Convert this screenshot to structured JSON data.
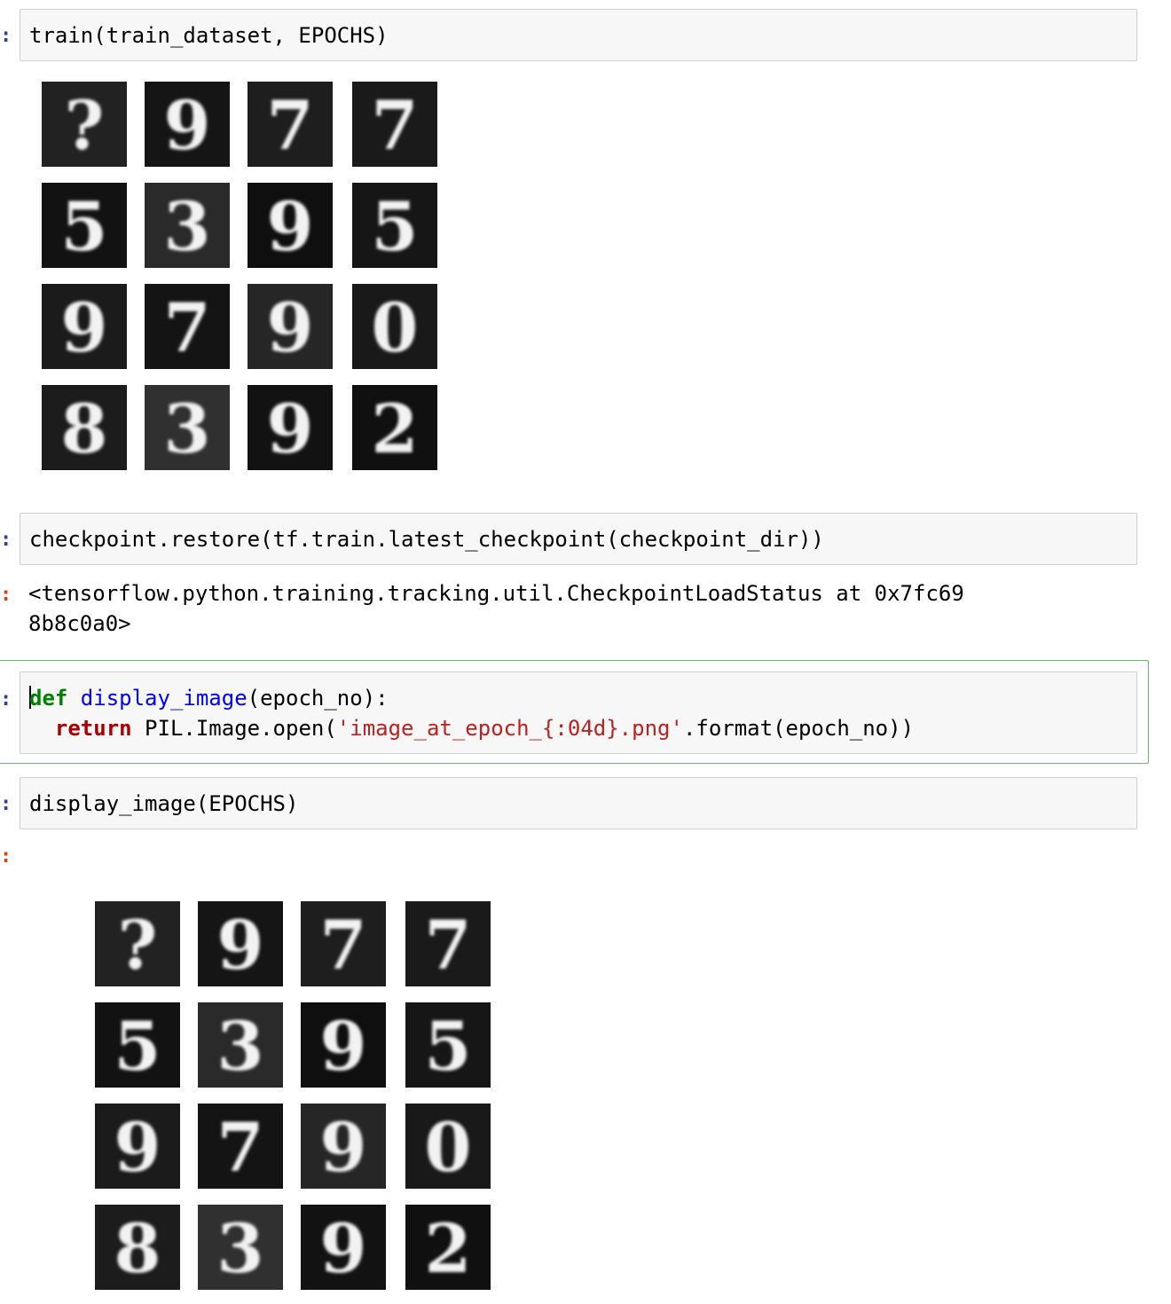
{
  "cells": [
    {
      "prompt": ":",
      "code": "train(train_dataset, EPOCHS)"
    },
    {
      "prompt": ":",
      "code": "checkpoint.restore(tf.train.latest_checkpoint(checkpoint_dir))",
      "output_prompt": ":",
      "output_line1": "<tensorflow.python.training.tracking.util.CheckpointLoadStatus at 0x7fc69",
      "output_line2": "8b8c0a0>"
    },
    {
      "prompt": ":",
      "code_line1": {
        "kw": "def",
        "fn": " display_image",
        "rest": "(epoch_no):"
      },
      "code_line2": {
        "indent": "  ",
        "kw": "return",
        "pre": " PIL.Image.open(",
        "str": "'image_at_epoch_{:04d}.png'",
        "post": ".format(epoch_no))"
      }
    },
    {
      "prompt": ":",
      "code": "display_image(EPOCHS)",
      "output_prompt": ":"
    }
  ],
  "digit_grid": {
    "digits": [
      [
        "?",
        "9",
        "7",
        "7"
      ],
      [
        "5",
        "3",
        "9",
        "5"
      ],
      [
        "9",
        "7",
        "9",
        "0"
      ],
      [
        "8",
        "3",
        "9",
        "2"
      ]
    ],
    "backgrounds": [
      [
        "#222222",
        "#151515",
        "#1e1e1e",
        "#1a1a1a"
      ],
      [
        "#121212",
        "#2a2a2a",
        "#0f0f0f",
        "#161616"
      ],
      [
        "#1b1b1b",
        "#141414",
        "#262626",
        "#191919"
      ],
      [
        "#1c1c1c",
        "#303030",
        "#121212",
        "#101010"
      ]
    ]
  }
}
